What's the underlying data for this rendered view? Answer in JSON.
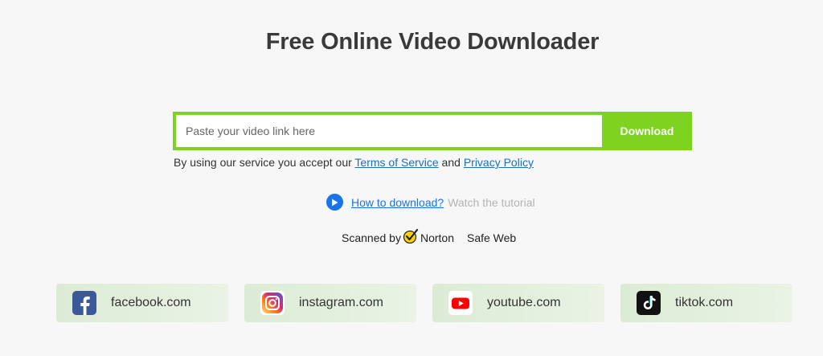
{
  "header": {
    "title": "Free Online Video Downloader"
  },
  "search": {
    "placeholder": "Paste your video link here",
    "value": "",
    "button_label": "Download"
  },
  "terms": {
    "prefix": "By using our service you accept our ",
    "terms_link": "Terms of Service",
    "middle": " and ",
    "privacy_link": "Privacy Policy"
  },
  "howto": {
    "link": "How to download?",
    "hint": "Watch the tutorial"
  },
  "security": {
    "prefix": "Scanned by",
    "brand": "Norton",
    "suffix": "Safe Web"
  },
  "sites": [
    {
      "label": "facebook.com",
      "icon": "facebook-icon"
    },
    {
      "label": "instagram.com",
      "icon": "instagram-icon"
    },
    {
      "label": "youtube.com",
      "icon": "youtube-icon"
    },
    {
      "label": "tiktok.com",
      "icon": "tiktok-icon"
    }
  ],
  "colors": {
    "accent": "#7ed321",
    "link": "#1a73e8",
    "background": "#f7f7f7"
  }
}
